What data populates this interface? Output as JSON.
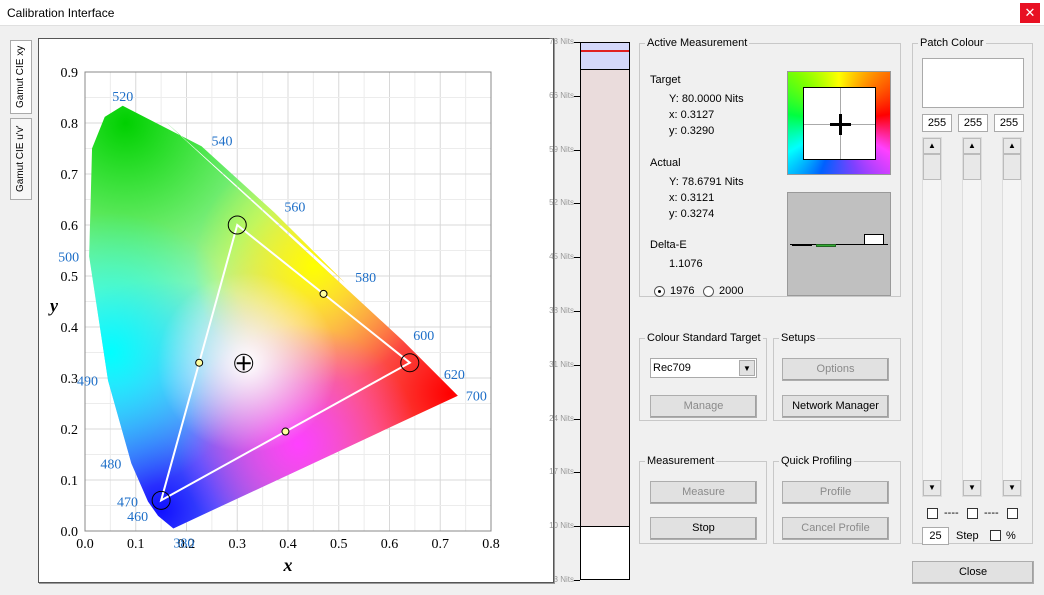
{
  "window": {
    "title": "Calibration Interface",
    "close_icon": "close-icon"
  },
  "tabs": [
    {
      "label": "Gamut CIE xy",
      "active": true
    },
    {
      "label": "Gamut CIE u'v'",
      "active": false
    }
  ],
  "chart_data": {
    "type": "scatter",
    "title": "",
    "xlabel": "x",
    "ylabel": "y",
    "xlim": [
      0,
      0.8
    ],
    "ylim": [
      0,
      0.9
    ],
    "xticks": [
      "0.0",
      "0.1",
      "0.2",
      "0.3",
      "0.4",
      "0.5",
      "0.6",
      "0.7",
      "0.8"
    ],
    "yticks": [
      "0.0",
      "0.1",
      "0.2",
      "0.3",
      "0.4",
      "0.5",
      "0.6",
      "0.7",
      "0.8",
      "0.9"
    ],
    "grid": true,
    "spectral_locus_labels": [
      {
        "nm": "380",
        "x": 0.1741,
        "y": 0.005
      },
      {
        "nm": "460",
        "x": 0.144,
        "y": 0.0297
      },
      {
        "nm": "470",
        "x": 0.1241,
        "y": 0.0578
      },
      {
        "nm": "480",
        "x": 0.0913,
        "y": 0.1327
      },
      {
        "nm": "490",
        "x": 0.0454,
        "y": 0.295
      },
      {
        "nm": "500",
        "x": 0.0082,
        "y": 0.5384
      },
      {
        "nm": "520",
        "x": 0.0743,
        "y": 0.8338
      },
      {
        "nm": "540",
        "x": 0.2296,
        "y": 0.7543
      },
      {
        "nm": "560",
        "x": 0.3731,
        "y": 0.6245
      },
      {
        "nm": "580",
        "x": 0.5125,
        "y": 0.4866
      },
      {
        "nm": "600",
        "x": 0.627,
        "y": 0.3725
      },
      {
        "nm": "620",
        "x": 0.6915,
        "y": 0.3083
      },
      {
        "nm": "700",
        "x": 0.7347,
        "y": 0.2653
      }
    ],
    "gamut_triangle": [
      {
        "name": "red",
        "x": 0.64,
        "y": 0.33
      },
      {
        "name": "green",
        "x": 0.3,
        "y": 0.6
      },
      {
        "name": "blue",
        "x": 0.15,
        "y": 0.06
      }
    ],
    "white_point": {
      "x": 0.3127,
      "y": 0.329
    }
  },
  "nits_scale": {
    "ticks": [
      "73 Nits",
      "66 Nits",
      "59 Nits",
      "52 Nits",
      "45 Nits",
      "38 Nits",
      "31 Nits",
      "24 Nits",
      "17 Nits",
      "10 Nits",
      "3 Nits"
    ],
    "range": [
      3,
      73
    ],
    "target_line": 72,
    "measured_top": 69.5,
    "lower_limit": 10
  },
  "active_measurement": {
    "legend": "Active Measurement",
    "target_label": "Target",
    "target": {
      "Y": "Y: 80.0000 Nits",
      "x": "x: 0.3127",
      "y": "y: 0.3290"
    },
    "actual_label": "Actual",
    "actual": {
      "Y": "Y: 78.6791 Nits",
      "x": "x: 0.3121",
      "y": "y: 0.3274"
    },
    "delta_label": "Delta-E",
    "delta_value": "1.1076",
    "radio_1976": "1976",
    "radio_2000": "2000",
    "selected": "1976"
  },
  "colour_standard": {
    "legend": "Colour Standard Target",
    "selected": "Rec709",
    "manage": "Manage"
  },
  "setups": {
    "legend": "Setups",
    "options": "Options",
    "network_manager": "Network Manager"
  },
  "measurement": {
    "legend": "Measurement",
    "measure": "Measure",
    "stop": "Stop"
  },
  "quick_profiling": {
    "legend": "Quick Profiling",
    "profile": "Profile",
    "cancel_profile": "Cancel Profile"
  },
  "patch_colour": {
    "legend": "Patch Colour",
    "r": "255",
    "g": "255",
    "b": "255",
    "link1": "----",
    "link2": "----",
    "step_value": "25",
    "step_label": "Step",
    "percent_label": "%"
  },
  "close_button": "Close"
}
